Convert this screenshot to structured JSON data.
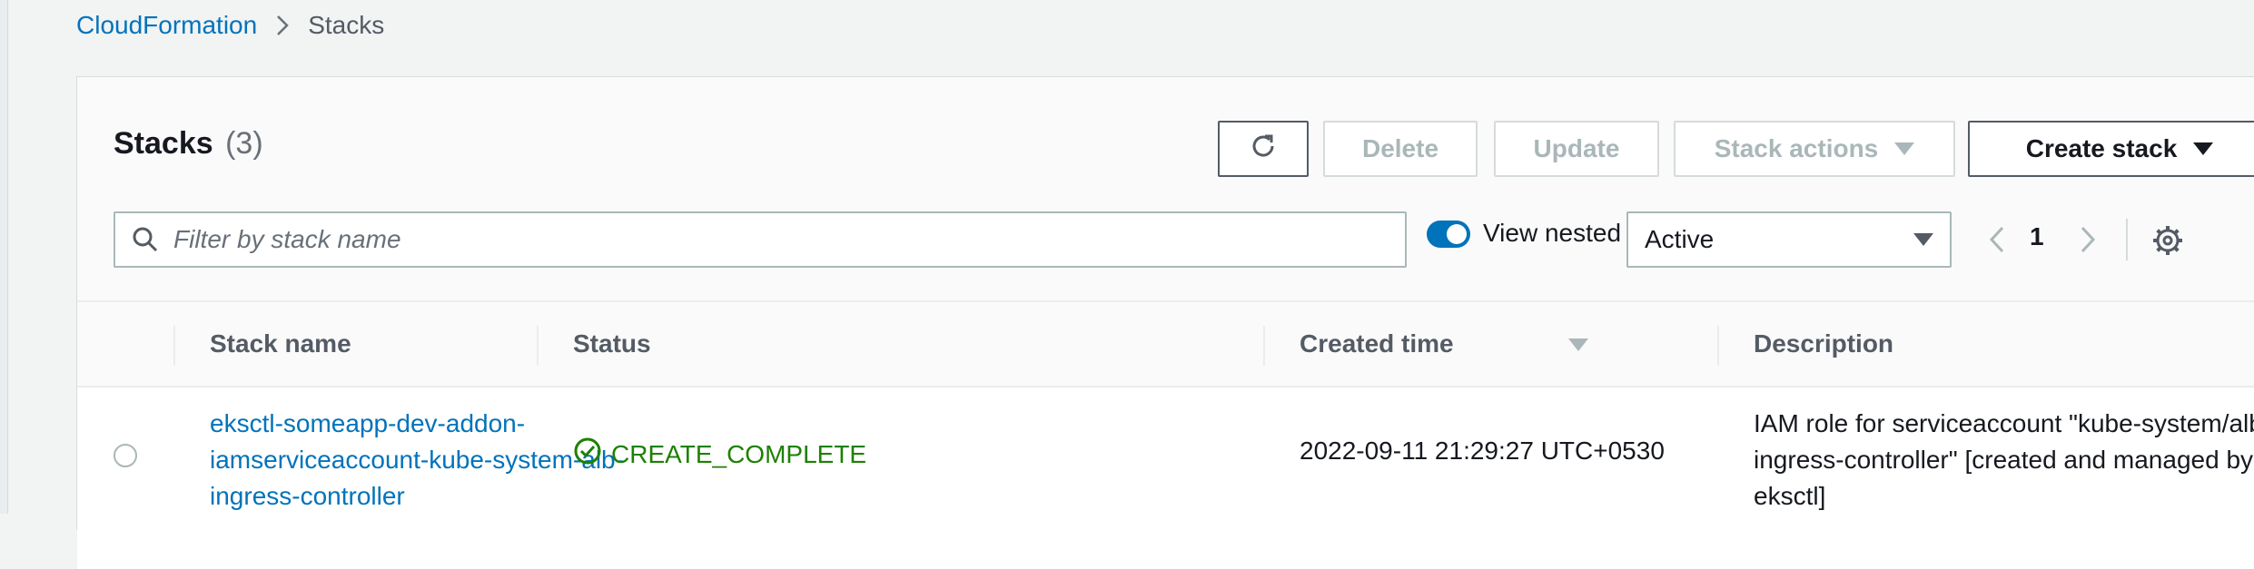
{
  "breadcrumb": {
    "root": "CloudFormation",
    "current": "Stacks"
  },
  "header": {
    "title": "Stacks",
    "count": "(3)"
  },
  "toolbar": {
    "refresh_icon": "refresh-icon",
    "delete_label": "Delete",
    "update_label": "Update",
    "stack_actions_label": "Stack actions",
    "create_stack_label": "Create stack"
  },
  "filter": {
    "placeholder": "Filter by stack name",
    "value": ""
  },
  "view_nested": {
    "label": "View nested",
    "checked": true
  },
  "status_filter": {
    "selected": "Active"
  },
  "pagination": {
    "current_page": "1"
  },
  "table": {
    "columns": [
      "Stack name",
      "Status",
      "Created time",
      "Description"
    ],
    "rows": [
      {
        "stack_name": "eksctl-someapp-dev-addon-iamserviceaccount-kube-system-alb-ingress-controller",
        "status": "CREATE_COMPLETE",
        "created_time": "2022-09-11 21:29:27 UTC+0530",
        "description": "IAM role for serviceaccount \"kube-system/alb-ingress-controller\" [created and managed by eksctl]"
      }
    ]
  },
  "colors": {
    "link": "#0073bb",
    "success": "#1d8102",
    "toggle": "#0073bb"
  }
}
